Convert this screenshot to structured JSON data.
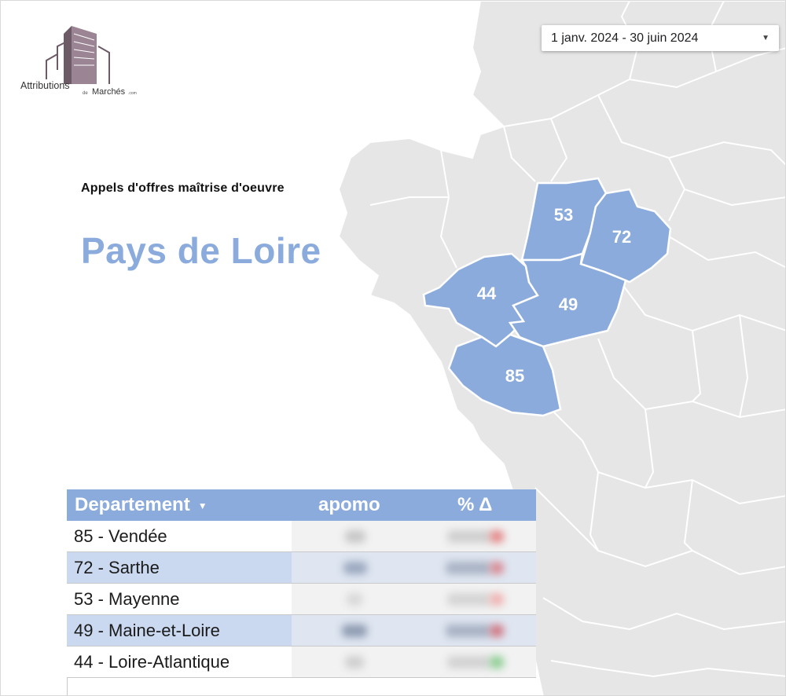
{
  "header": {
    "date_range": "1 janv. 2024 - 30 juin 2024"
  },
  "logo": {
    "text_main": "Attributions",
    "text_de": "de",
    "text_marches": "Marchés",
    "text_com": ".com"
  },
  "titles": {
    "subtitle": "Appels d'offres maîtrise d'oeuvre",
    "region": "Pays de Loire"
  },
  "map": {
    "highlight_color": "#8aabdc",
    "base_color": "#e6e6e6",
    "labels": [
      "53",
      "72",
      "44",
      "49",
      "85"
    ]
  },
  "table": {
    "header_color": "#8aabdc",
    "columns": [
      "Departement",
      "apomo",
      "% Δ"
    ],
    "rows": [
      {
        "name": "85 - Vendée",
        "status": "down"
      },
      {
        "name": "72 - Sarthe",
        "status": "down"
      },
      {
        "name": "53 - Mayenne",
        "status": "down"
      },
      {
        "name": "49 - Maine-et-Loire",
        "status": "down"
      },
      {
        "name": "44 - Loire-Atlantique",
        "status": "up"
      }
    ]
  },
  "colors": {
    "accent": "#8aabdc",
    "row_alt": "#cad9ef",
    "negative": "#e58a8a",
    "positive": "#8fcf95"
  }
}
